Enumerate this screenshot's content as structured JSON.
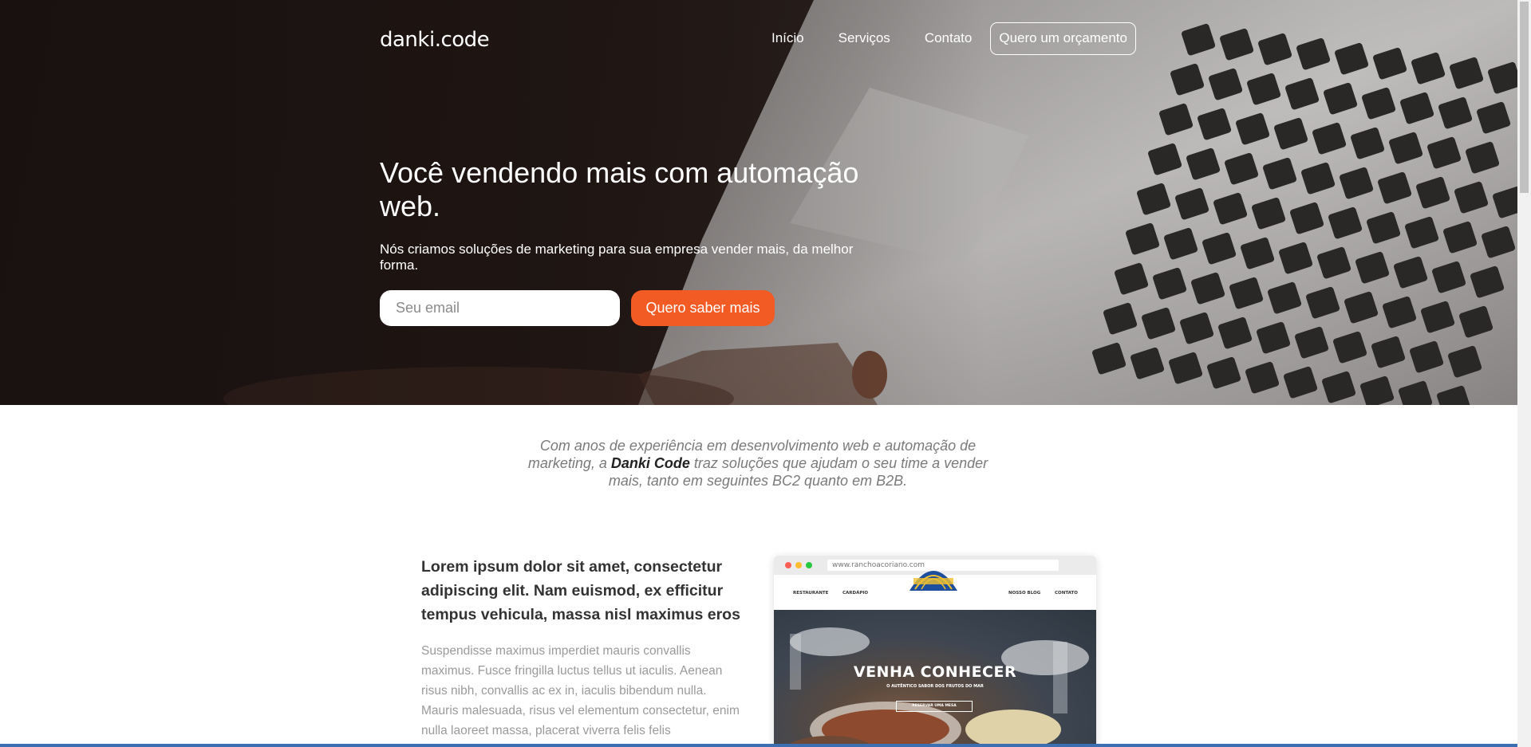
{
  "nav": {
    "logo": "danki.code",
    "links": [
      "Início",
      "Serviços",
      "Contato"
    ],
    "cta": "Quero um orçamento"
  },
  "hero": {
    "title": "Você vendendo mais com automação web.",
    "subtitle": "Nós criamos soluções de marketing para sua empresa vender mais, da melhor forma.",
    "email_placeholder": "Seu email",
    "button": "Quero saber mais"
  },
  "intro": {
    "before": "Com anos de experiência em desenvolvimento web e automação de marketing, a ",
    "brand": "Danki Code",
    "after": " traz soluções que ajudam o seu time a vender mais, tanto em seguintes BC2 quanto em B2B."
  },
  "feature": {
    "title": "Lorem ipsum dolor sit amet, consectetur adipiscing elit. Nam euismod, ex efficitur tempus vehicula, massa nisl maximus eros",
    "text": "Suspendisse maximus imperdiet mauris convallis maximus. Fusce fringilla luctus tellus ut iaculis. Aenean risus nibh, convallis ac ex in, iaculis bibendum nulla. Mauris malesuada, risus vel elementum consectetur, enim nulla laoreet massa, placerat viverra felis felis"
  },
  "mockup": {
    "url": "www.ranchoacoriano.com",
    "nav_items": [
      "RESTAURANTE",
      "CARDÁPIO",
      "NOSSO BLOG",
      "CONTATO"
    ],
    "headline": "VENHA CONHECER",
    "subline": "O AUTÊNTICO SABOR DOS FRUTOS DO MAR",
    "button": "RESERVAR UMA MESA"
  },
  "colors": {
    "accent": "#f35b25",
    "hero_dark": "#1e1716"
  }
}
